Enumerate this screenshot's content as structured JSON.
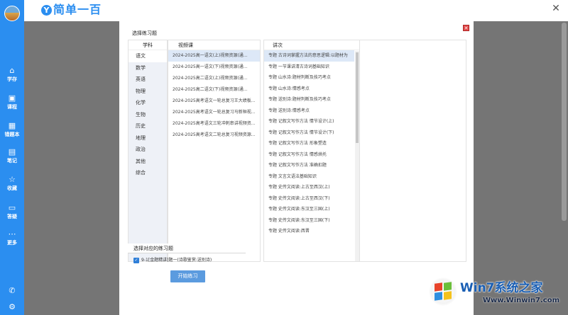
{
  "app": {
    "logo_mark": "Y",
    "name": "简单一百"
  },
  "sidebar": {
    "items": [
      {
        "icon": "home-icon",
        "glyph": "⌂",
        "label": "学存"
      },
      {
        "icon": "calendar-icon",
        "glyph": "▣",
        "label": "课程"
      },
      {
        "icon": "grid-icon",
        "glyph": "▦",
        "label": "错题本"
      },
      {
        "icon": "note-icon",
        "glyph": "▤",
        "label": "笔记"
      },
      {
        "icon": "star-icon",
        "glyph": "☆",
        "label": "收藏"
      },
      {
        "icon": "chat-icon",
        "glyph": "▭",
        "label": "答疑"
      },
      {
        "icon": "more-icon",
        "glyph": "⋯",
        "label": "更多"
      }
    ],
    "bottom": [
      {
        "icon": "phone-icon",
        "glyph": "✆"
      },
      {
        "icon": "gear-icon",
        "glyph": "⚙"
      }
    ]
  },
  "modal": {
    "title": "选择练习题",
    "close_glyph": "✕",
    "subjects_header": "学科",
    "subjects": [
      "语文",
      "数学",
      "英语",
      "物理",
      "化学",
      "生物",
      "历史",
      "地理",
      "政治",
      "其他",
      "综合"
    ],
    "active_subject": 0,
    "videos_header": "视频课",
    "videos": [
      "2024-2025高一语文(上)视频资源(通...",
      "2024-2025高一语文(下)视频资源(通...",
      "2024-2025高二语文(上)视频资源(通...",
      "2024-2025高二语文(下)视频资源(通...",
      "2024-2025高考语文一轮总复习王大绩板...",
      "2024-2025高考语文一轮总复习马新桓视...",
      "2024-2025高考语文三轮冲刺串讲视频资...",
      "2024-2025高考语文二轮总复习视频资源..."
    ],
    "active_video": 0,
    "lessons_header": "讲次",
    "lessons": [
      "专题 古诗词掌握方法的意思逻辑:以题材为",
      "专题 一节课讲清古诗词基础知识",
      "专题 山水诗:题材判断及技巧考点",
      "专题 山水诗:情感考点",
      "专题 送别诗:题材判断及技巧考点",
      "专题 送别诗:情感考点",
      "专题 记叙文写作方法 情节设计(上)",
      "专题 记叙文写作方法 情节设计(下)",
      "专题 记叙文写作方法 形象塑造",
      "专题 记叙文写作方法 情感烘托",
      "专题 记叙文写作方法 准确扣题",
      "专题 文言文语法基础知识",
      "专题 史传文阅读:上古至西汉(上)",
      "专题 史传文阅读:上古至西汉(下)",
      "专题 史传文阅读:东汉至三国(上)",
      "专题 史传文阅读:东汉至三国(下)",
      "专题 史传文阅读:西晋"
    ],
    "active_lesson": 0,
    "exercise_header": "选择对应的练习题",
    "exercise_item": "9-1[金题精讲]题一(诗歌鉴赏:送别诗)",
    "exercise_checked": true,
    "start_button": "开始练习"
  },
  "watermark": {
    "title": "Win7系统之家",
    "url": "Www.Winwin7.com"
  }
}
